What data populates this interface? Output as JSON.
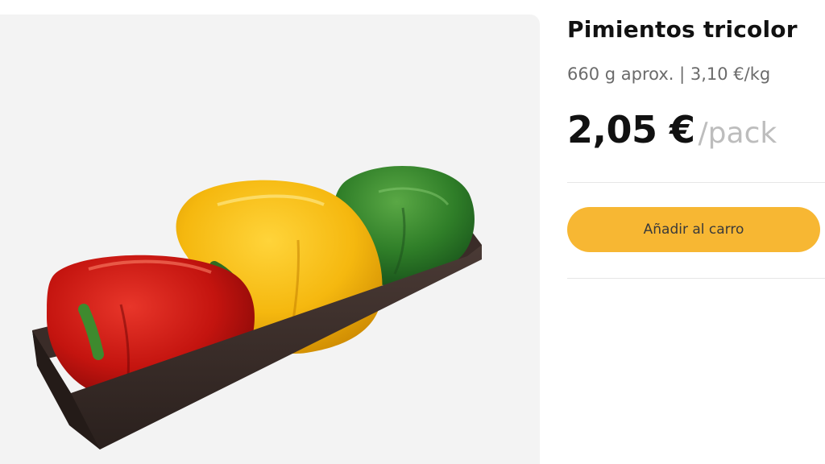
{
  "product": {
    "image_alt": "product-photo",
    "title": "Pimientos tricolor",
    "meta": "660 g aprox. | 3,10 €/kg",
    "price": "2,05 €",
    "price_unit": "/pack",
    "add_to_cart_label": "Añadir al carro"
  },
  "colors": {
    "accent": "#f7b733",
    "image_background": "#f3f3f3",
    "muted_text": "#6b6b6b",
    "price_unit_text": "#bdbdbd"
  }
}
